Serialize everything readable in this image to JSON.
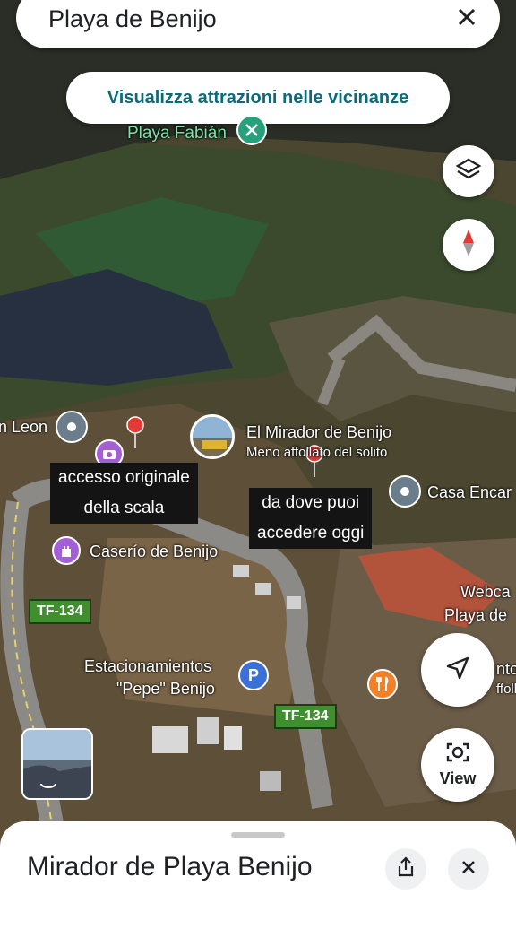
{
  "search": {
    "title": "Playa de Benijo"
  },
  "nearby_button": {
    "label": "Visualizza attrazioni nelle vicinanze"
  },
  "map_labels": {
    "playa_fabian": "Playa Fabián",
    "leon": "n Leon",
    "mirador": "El Mirador de Benijo",
    "mirador_sub": "Meno affollato del solito",
    "casa": "Casa Encar",
    "caserio": "Caserío de Benijo",
    "webcam_1": "Webca",
    "webcam_2": "Playa de",
    "parking_1": "Estacionamientos",
    "parking_2": "\"Pepe\" Benijo",
    "right_1": "nto",
    "right_2": "ffolla"
  },
  "notes": {
    "note1_line1": "accesso originale",
    "note1_line2": "della scala",
    "note2_line1": "da dove puoi",
    "note2_line2": "accedere oggi"
  },
  "road_signs": {
    "sign1": "TF-134",
    "sign2": "TF-134"
  },
  "view_button": {
    "label": "View"
  },
  "sheet": {
    "title": "Mirador de Playa Benijo"
  },
  "icons": [
    "close-icon",
    "layers-icon",
    "compass-icon",
    "navigate-icon",
    "camera-lens-icon",
    "share-icon",
    "parking-icon",
    "restaurant-icon",
    "castle-icon",
    "location-pin-icon"
  ]
}
